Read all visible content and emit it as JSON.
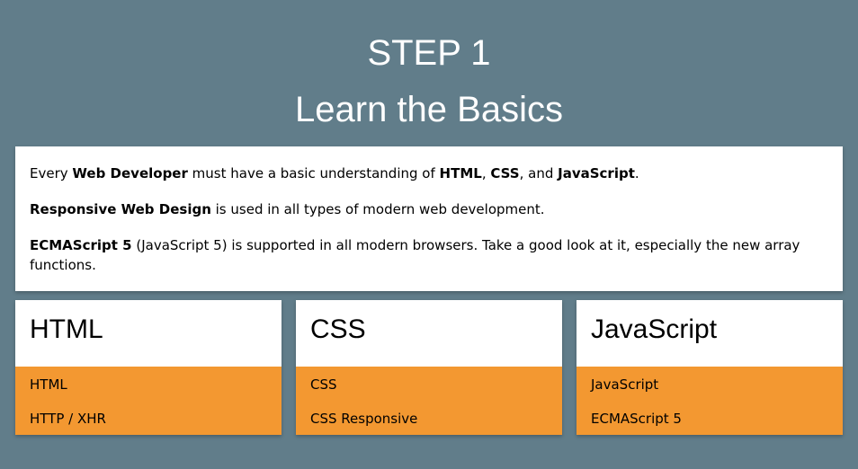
{
  "header": {
    "step": "STEP 1",
    "title": "Learn the Basics"
  },
  "intro": {
    "p1": {
      "t1": "Every ",
      "b1": "Web Developer",
      "t2": " must have a basic understanding of ",
      "b2": "HTML",
      "t3": ", ",
      "b3": "CSS",
      "t4": ", and ",
      "b4": "JavaScript",
      "t5": "."
    },
    "p2": {
      "b1": "Responsive Web Design",
      "t1": " is used in all types of modern web development."
    },
    "p3": {
      "b1": "ECMAScript 5",
      "t1": " (JavaScript 5) is supported in all modern browsers. Take a good look at it, especially the new array functions."
    }
  },
  "cards": [
    {
      "title": "HTML",
      "links": [
        "HTML",
        "HTTP / XHR"
      ]
    },
    {
      "title": "CSS",
      "links": [
        "CSS",
        "CSS Responsive"
      ]
    },
    {
      "title": "JavaScript",
      "links": [
        "JavaScript",
        "ECMAScript 5"
      ]
    }
  ],
  "colors": {
    "background": "#617d8a",
    "card_footer": "#f39831",
    "panel": "#ffffff"
  }
}
